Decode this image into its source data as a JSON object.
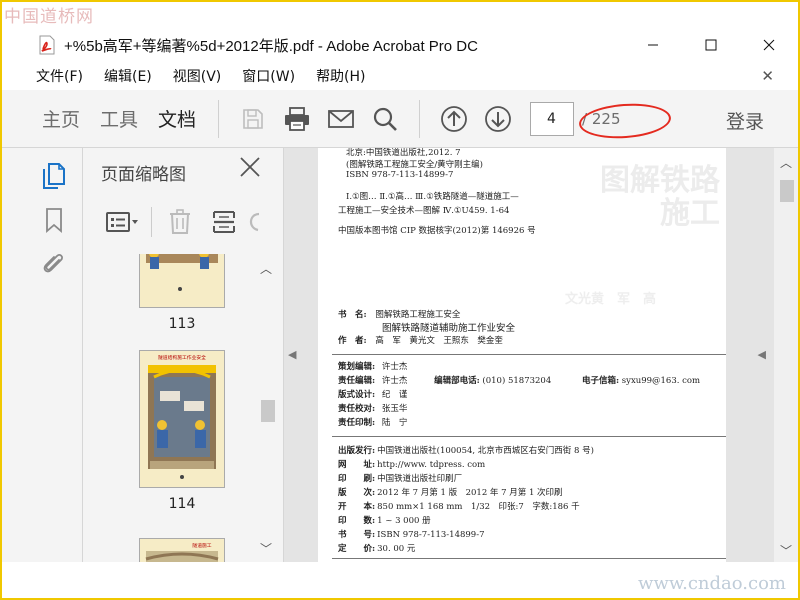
{
  "watermarks": {
    "top": "中国道桥网",
    "bottom": "www.cndao.com"
  },
  "window": {
    "title": "+%5b高军+等编著%5d+2012年版.pdf - Adobe Acrobat Pro DC"
  },
  "menu": {
    "items": [
      "文件(F)",
      "编辑(E)",
      "视图(V)",
      "窗口(W)",
      "帮助(H)"
    ]
  },
  "toolbar": {
    "tabs": [
      "主页",
      "工具",
      "文档"
    ],
    "active_tab": "文档",
    "page_current": "4",
    "page_total": "/ 225",
    "login": "登录"
  },
  "thumbnails": {
    "title": "页面缩略图",
    "pages": [
      "113",
      "114"
    ],
    "thumb_headers": [
      "",
      "隧道结构施工作业安全",
      "隧道施工"
    ]
  },
  "document": {
    "cip_lines": [
      "北京:中国铁道出版社,2012. 7",
      "(图解铁路工程施工安全/黄守刚主编)",
      "ISBN 978-7-113-14899-7",
      "Ⅰ.①图… Ⅱ.①高… Ⅲ.①铁路隧道—隧道施工—",
      "工程施工—安全技术—图解 Ⅳ.①U459. 1-64",
      "中国版本图书馆 CIP 数据核字(2012)第 146926 号"
    ],
    "book": {
      "series_label": "书　名:",
      "series": "图解铁路工程施工安全",
      "title": "图解铁路隧道辅助施工作业安全",
      "author_label": "作　者:",
      "authors": "高　军　黄光文　王照东　樊金奎"
    },
    "editors": {
      "planning_label": "策划编辑:",
      "planning": "许士杰",
      "responsible_label": "责任编辑:",
      "responsible": "许士杰",
      "phone_label": "编辑部电话:",
      "phone": "(010) 51873204",
      "email_label": "电子信箱:",
      "email": "syxu99@163. com",
      "design_label": "版式设计:",
      "design": "纪　谨",
      "proof_label": "责任校对:",
      "proof": "张玉华",
      "print_label": "责任印制:",
      "print": "陆　宁"
    },
    "publish": [
      {
        "label": "出版发行:",
        "value": "中国铁道出版社(100054, 北京市西城区右安门西街 8 号)"
      },
      {
        "label": "网　　址:",
        "value": "http://www. tdpress. com"
      },
      {
        "label": "印　　刷:",
        "value": "中国铁道出版社印刷厂"
      },
      {
        "label": "版　　次:",
        "value": "2012 年 7 月第 1 版　2012 年 7 月第 1 次印刷"
      },
      {
        "label": "开　　本:",
        "value": "850 mm×1 168 mm　1/32　印张:7　字数:186 千"
      },
      {
        "label": "印　　数:",
        "value": "1 ~ 3 000 册"
      },
      {
        "label": "书　　号:",
        "value": "ISBN 978-7-113-14899-7"
      },
      {
        "label": "定　　价:",
        "value": "30. 00 元"
      }
    ],
    "ghost_title": [
      "图解铁路",
      "施工"
    ],
    "ghost_authors": "文光黄　军　高"
  },
  "colors": {
    "accent": "#1a73c7",
    "annotation": "#e42a1f",
    "border": "#f0c800"
  }
}
